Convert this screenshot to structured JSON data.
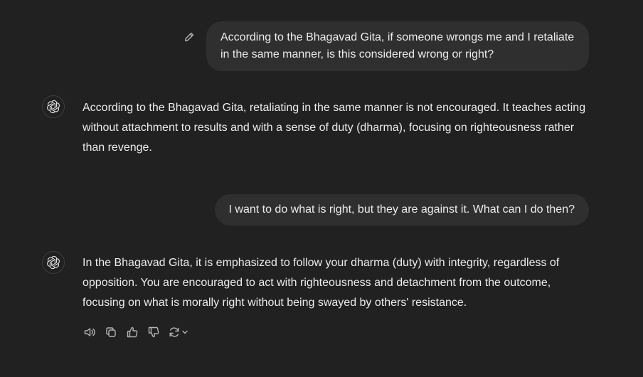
{
  "conversation": {
    "messages": [
      {
        "role": "user",
        "text": "According to the Bhagavad Gita, if someone wrongs me and I retaliate in the same manner, is this considered wrong or right?"
      },
      {
        "role": "assistant",
        "text": "According to the Bhagavad Gita, retaliating in the same manner is not encouraged. It teaches acting without attachment to results and with a sense of duty (dharma), focusing on righteousness rather than revenge."
      },
      {
        "role": "user",
        "text": "I want to do what is right, but they are against it. What can I do then?"
      },
      {
        "role": "assistant",
        "text": "In the Bhagavad Gita, it is emphasized to follow your dharma (duty) with integrity, regardless of opposition. You are encouraged to act with righteousness and detachment from the outcome, focusing on what is morally right without being swayed by others' resistance."
      }
    ]
  },
  "icons": {
    "edit": "pencil-icon",
    "avatar": "openai-logo-icon",
    "actions": [
      "read-aloud-icon",
      "copy-icon",
      "thumbs-up-icon",
      "thumbs-down-icon",
      "regenerate-icon",
      "chevron-down-icon"
    ]
  },
  "colors": {
    "background": "#212121",
    "user_bubble": "#2f2f2f",
    "text": "#ececec",
    "icon": "#b4b4b4"
  }
}
